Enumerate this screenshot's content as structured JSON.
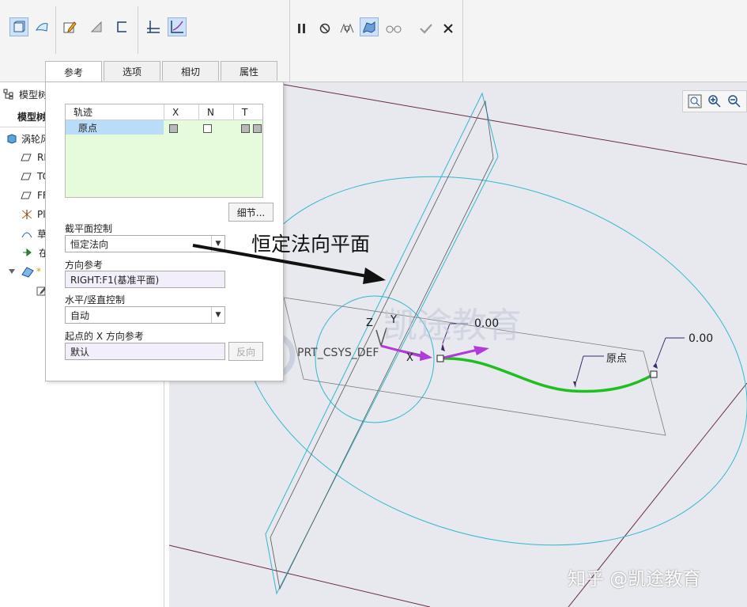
{
  "toolbar": {
    "left_icons": [
      "solid-icon",
      "surface-icon",
      "edit-sketch-icon",
      "plane-cut-icon",
      "open-bracket-icon",
      "constant-section-icon",
      "variable-section-icon"
    ],
    "right_icons": [
      "pause-icon",
      "stop-icon",
      "preview-off-icon",
      "preview-icon",
      "glasses-icon",
      "check-icon",
      "close-icon"
    ]
  },
  "tabs": [
    {
      "label": "参考",
      "active": true
    },
    {
      "label": "选项",
      "active": false
    },
    {
      "label": "相切",
      "active": false
    },
    {
      "label": "属性",
      "active": false
    }
  ],
  "tree": {
    "header_short": "模型树",
    "header_label": "模型树",
    "items": [
      {
        "icon": "part-icon",
        "label": "涡轮风"
      },
      {
        "icon": "datum-plane-icon",
        "label": "RI"
      },
      {
        "icon": "datum-plane-icon",
        "label": "TC"
      },
      {
        "icon": "datum-plane-icon",
        "label": "FF"
      },
      {
        "icon": "csys-icon",
        "label": "Pl"
      },
      {
        "icon": "sketch-icon",
        "label": "草"
      },
      {
        "icon": "insert-arrow-icon",
        "label": "在"
      },
      {
        "icon": "sweep-feature-icon",
        "label": "*"
      }
    ]
  },
  "panel": {
    "trajectory_table": {
      "headers": [
        "轨迹",
        "X",
        "N",
        "T"
      ],
      "rows": [
        {
          "name": "原点",
          "x": "grey",
          "n": "unchecked",
          "t": "grey"
        }
      ]
    },
    "details_button": "细节...",
    "section_control_label": "截平面控制",
    "section_control_value": "恒定法向",
    "direction_ref_label": "方向参考",
    "direction_ref_value": "RIGHT:F1(基准平面)",
    "hv_control_label": "水平/竖直控制",
    "hv_control_value": "自动",
    "start_x_label": "起点的 X 方向参考",
    "start_x_value": "默认",
    "flip_button": "反向"
  },
  "viewport": {
    "view_icons": [
      "zoom-fit-icon",
      "zoom-in-icon",
      "zoom-out-icon"
    ],
    "csys_label": "PRT_CSYS_DEF",
    "axis_z": "Z",
    "axis_y": "Y",
    "axis_x": "X",
    "dim_start": "0.00",
    "dim_end": "0.00",
    "origin_label": "原点"
  },
  "annotation": {
    "callout": "恒定法向平面",
    "watermark_logo_text": "凯途教育",
    "footer_watermark": "知乎 @凯途教育"
  },
  "colors": {
    "sweep_curve": "#1fbf1f",
    "circle": "#31b7cf",
    "datum": "#6b2a47",
    "arrow": "#b13ad8"
  }
}
